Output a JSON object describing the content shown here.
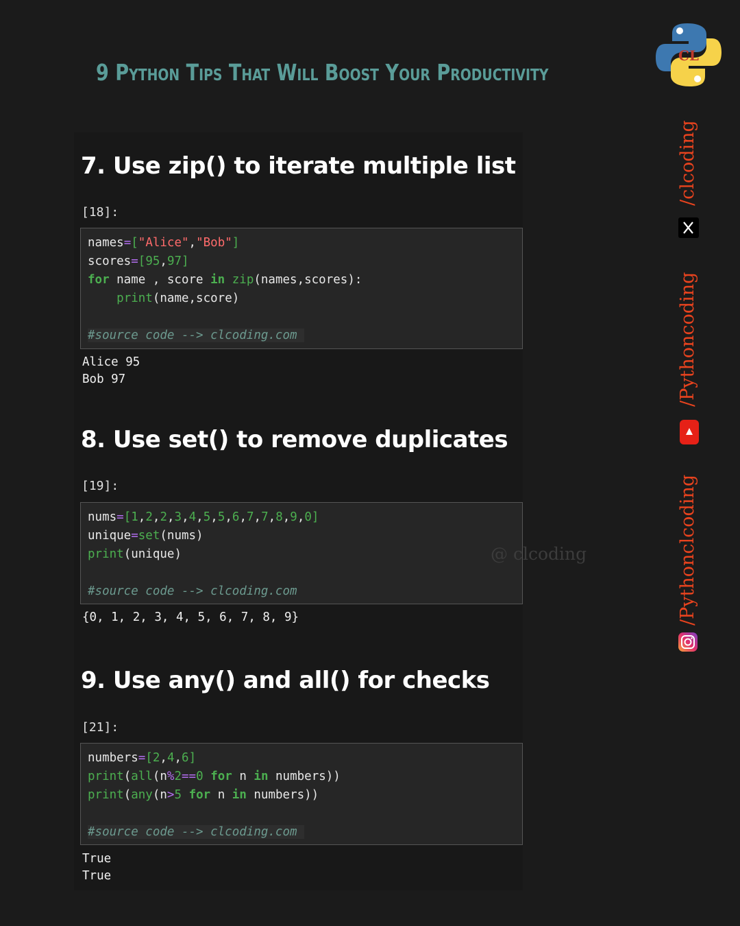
{
  "header": {
    "title": "9 Python Tips That Will Boost Your Productivity",
    "logo_text": "CL"
  },
  "sections": [
    {
      "heading": "7. Use zip() to iterate multiple list",
      "prompt": "[18]:",
      "code_lines": [
        "names=[\"Alice\",\"Bob\"]",
        "scores=[95,97]",
        "for name , score in zip(names,scores):",
        "    print(name,score)",
        "",
        "#source code --> clcoding.com"
      ],
      "output": [
        "Alice 95",
        "Bob 97"
      ]
    },
    {
      "heading": "8. Use set() to remove duplicates",
      "prompt": "[19]:",
      "code_lines": [
        "nums=[1,2,2,3,4,5,5,6,7,7,8,9,0]",
        "unique=set(nums)",
        "print(unique)",
        "",
        "#source code --> clcoding.com"
      ],
      "output": [
        "{0, 1, 2, 3, 4, 5, 6, 7, 8, 9}"
      ]
    },
    {
      "heading": "9. Use any() and all() for checks",
      "prompt": "[21]:",
      "code_lines": [
        "numbers=[2,4,6]",
        "print(all(n%2==0 for n in numbers))",
        "print(any(n>5 for n in numbers))",
        "",
        "#source code --> clcoding.com"
      ],
      "output": [
        "True",
        "True"
      ]
    }
  ],
  "watermark": "@ clcoding",
  "social": {
    "x_handle": "/clcoding",
    "youtube_handle": "/Pythoncoding",
    "instagram_handle": "/Pythonclcoding"
  },
  "colors": {
    "title": "#5a9c98",
    "social_text": "#e8431e",
    "keyword": "#4caf50",
    "string": "#ff6b6b",
    "operator": "#b36ef0"
  }
}
